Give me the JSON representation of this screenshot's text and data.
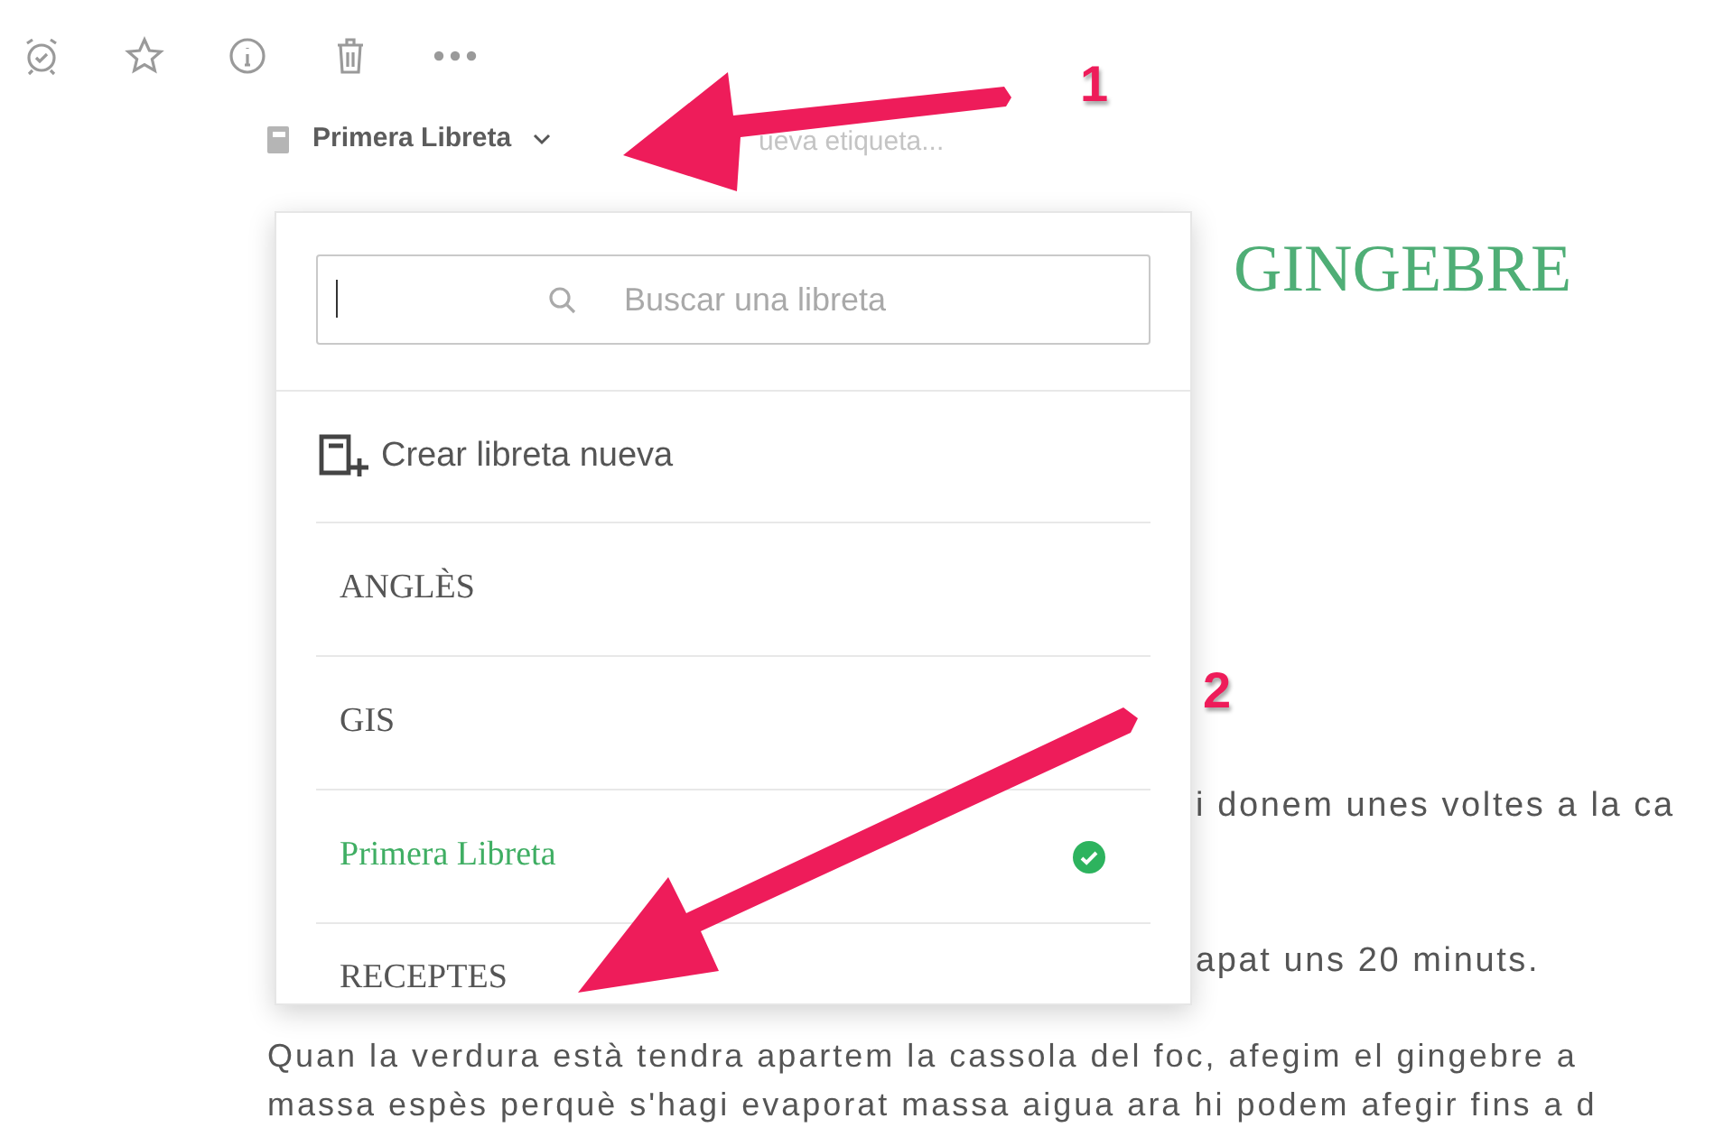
{
  "note_header": {
    "notebook": "Primera Libreta",
    "tag_placeholder": "ueva etiqueta..."
  },
  "note": {
    "title": "GINGEBRE",
    "fragments": [
      "i donem unes voltes a la ca",
      "apat uns 20 minuts."
    ],
    "paragraph_lines": [
      "Quan la verdura està tendra apartem la cassola del foc, afegim el gingebre a",
      "massa espès perquè s'hagi evaporat massa aigua ara hi podem afegir fins a d"
    ]
  },
  "notebook_menu": {
    "search_placeholder": "Buscar una libreta",
    "create_label": "Crear libreta nueva",
    "notebooks": [
      {
        "name": "ANGLÈS",
        "selected": false
      },
      {
        "name": "GIS",
        "selected": false
      },
      {
        "name": "Primera Libreta",
        "selected": true
      },
      {
        "name": "RECEPTES",
        "selected": false
      }
    ]
  },
  "annotations": [
    {
      "number": "1"
    },
    {
      "number": "2"
    }
  ]
}
